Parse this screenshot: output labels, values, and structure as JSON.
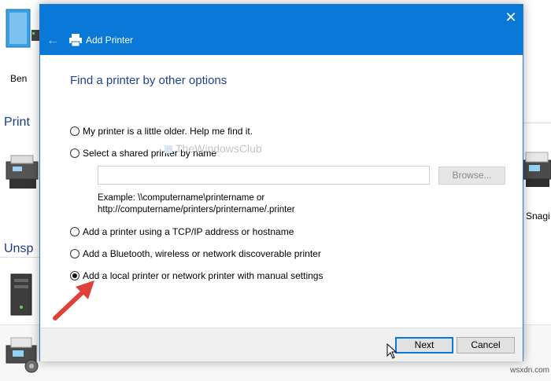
{
  "background": {
    "labels": {
      "ben": "Ben",
      "printers_section": "Print",
      "snagit": "Snagi",
      "unspecified_section": "Unsp"
    }
  },
  "dialog": {
    "title": "Add Printer",
    "heading": "Find a printer by other options",
    "options": [
      {
        "label": "My printer is a little older. Help me find it.",
        "checked": false
      },
      {
        "label": "Select a shared printer by name",
        "checked": false
      },
      {
        "label": "Add a printer using a TCP/IP address or hostname",
        "checked": false
      },
      {
        "label": "Add a Bluetooth, wireless or network discoverable printer",
        "checked": false
      },
      {
        "label": "Add a local printer or network printer with manual settings",
        "checked": true
      }
    ],
    "shared_name_input": {
      "value": "",
      "placeholder": ""
    },
    "browse_label": "Browse...",
    "example_line1": "Example: \\\\computername\\printername or",
    "example_line2": "http://computername/printers/printername/.printer",
    "watermark": "TheWindowsClub",
    "buttons": {
      "next": "Next",
      "cancel": "Cancel"
    }
  },
  "site_watermark": "wsxdn.com",
  "colors": {
    "titlebar": "#0a78d7",
    "heading": "#1f3f99",
    "arrow": "#e0403a"
  }
}
